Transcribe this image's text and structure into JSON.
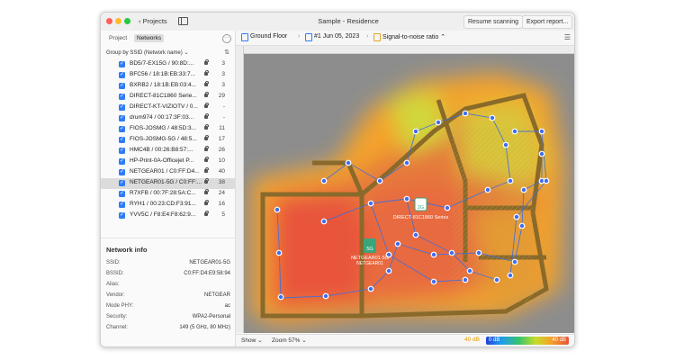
{
  "window": {
    "title": "Sample - Residence",
    "back_label": "Projects",
    "resume_label": "Resume scanning",
    "export_label": "Export report..."
  },
  "sidebar": {
    "tabs": [
      "Project",
      "Networks"
    ],
    "active_tab": "Networks",
    "group_by": "Group by SSID (Network name) ⌄",
    "networks": [
      {
        "name": "BD5/7-EX15G / 90:8D:...",
        "channel": "3",
        "checked": true
      },
      {
        "name": "BFC56 / 18:1B:EB:33:7...",
        "channel": "3",
        "checked": true
      },
      {
        "name": "BXRB2 / 18:1B:EB:03:4...",
        "channel": "3",
        "checked": true
      },
      {
        "name": "DIRECT-81C1860 Serie...",
        "channel": "29",
        "checked": true
      },
      {
        "name": "DIRECT-KT-VIZIOTV / 0...",
        "channel": "-",
        "checked": true
      },
      {
        "name": "drum974 / 00:17:3F:03...",
        "channel": "-",
        "checked": true
      },
      {
        "name": "FIOS-JOSMG / 48:5D:3...",
        "channel": "11",
        "checked": true
      },
      {
        "name": "FIOS-JOSMG-5G / 48:5...",
        "channel": "17",
        "checked": true
      },
      {
        "name": "HMC4B / 00:26:B8:57:...",
        "channel": "26",
        "checked": true
      },
      {
        "name": "HP-Print-0A-Officejet P...",
        "channel": "10",
        "checked": true
      },
      {
        "name": "NETGEAR01 / C0:FF:D4...",
        "channel": "40",
        "checked": true
      },
      {
        "name": "NETGEAR01-5G / C0:FF:...",
        "channel": "38",
        "checked": true,
        "selected": true
      },
      {
        "name": "R7XFB / 00:7F:28:5A:C...",
        "channel": "24",
        "checked": true
      },
      {
        "name": "RYH1 / 00:23:CD:F3:91...",
        "channel": "16",
        "checked": true
      },
      {
        "name": "YVV5C / F8:E4:F8:62:9...",
        "channel": "5",
        "checked": true
      }
    ],
    "info": {
      "title": "Network info",
      "rows": [
        {
          "k": "SSID:",
          "v": "NETGEAR01-5G"
        },
        {
          "k": "BSSID:",
          "v": "C0:FF:D4:E9:58:94"
        },
        {
          "k": "Alias:",
          "v": ""
        },
        {
          "k": "Vendor:",
          "v": "NETGEAR"
        },
        {
          "k": "Mode PHY:",
          "v": "ac"
        },
        {
          "k": "Security:",
          "v": "WPA2-Personal"
        },
        {
          "k": "Channel:",
          "v": "149 (5 GHz, 80 MHz)"
        }
      ]
    }
  },
  "breadcrumb": {
    "floor": "Ground Floor",
    "scan": "#1 Jun 05, 2023",
    "metric": "Signal-to-noise ratio ⌃"
  },
  "map": {
    "ap1_badge": "2G",
    "ap1_label": "DIRECT-81C1860 Series",
    "ap2_badge": "5G",
    "ap2_label": "NETGEAR01-5G",
    "ap2_sublabel": "NETGEAR01"
  },
  "statusbar": {
    "show_label": "Show ⌄",
    "zoom_label": "Zoom 57% ⌄",
    "legend_min": "40 dB",
    "legend_lo": "0 dB",
    "legend_hi": "40 dB"
  },
  "colors": {
    "accent": "#2f7cf6",
    "heat_strong": "#e8543b",
    "heat_weak": "#2140d8",
    "ap_green": "#3aa57a"
  }
}
